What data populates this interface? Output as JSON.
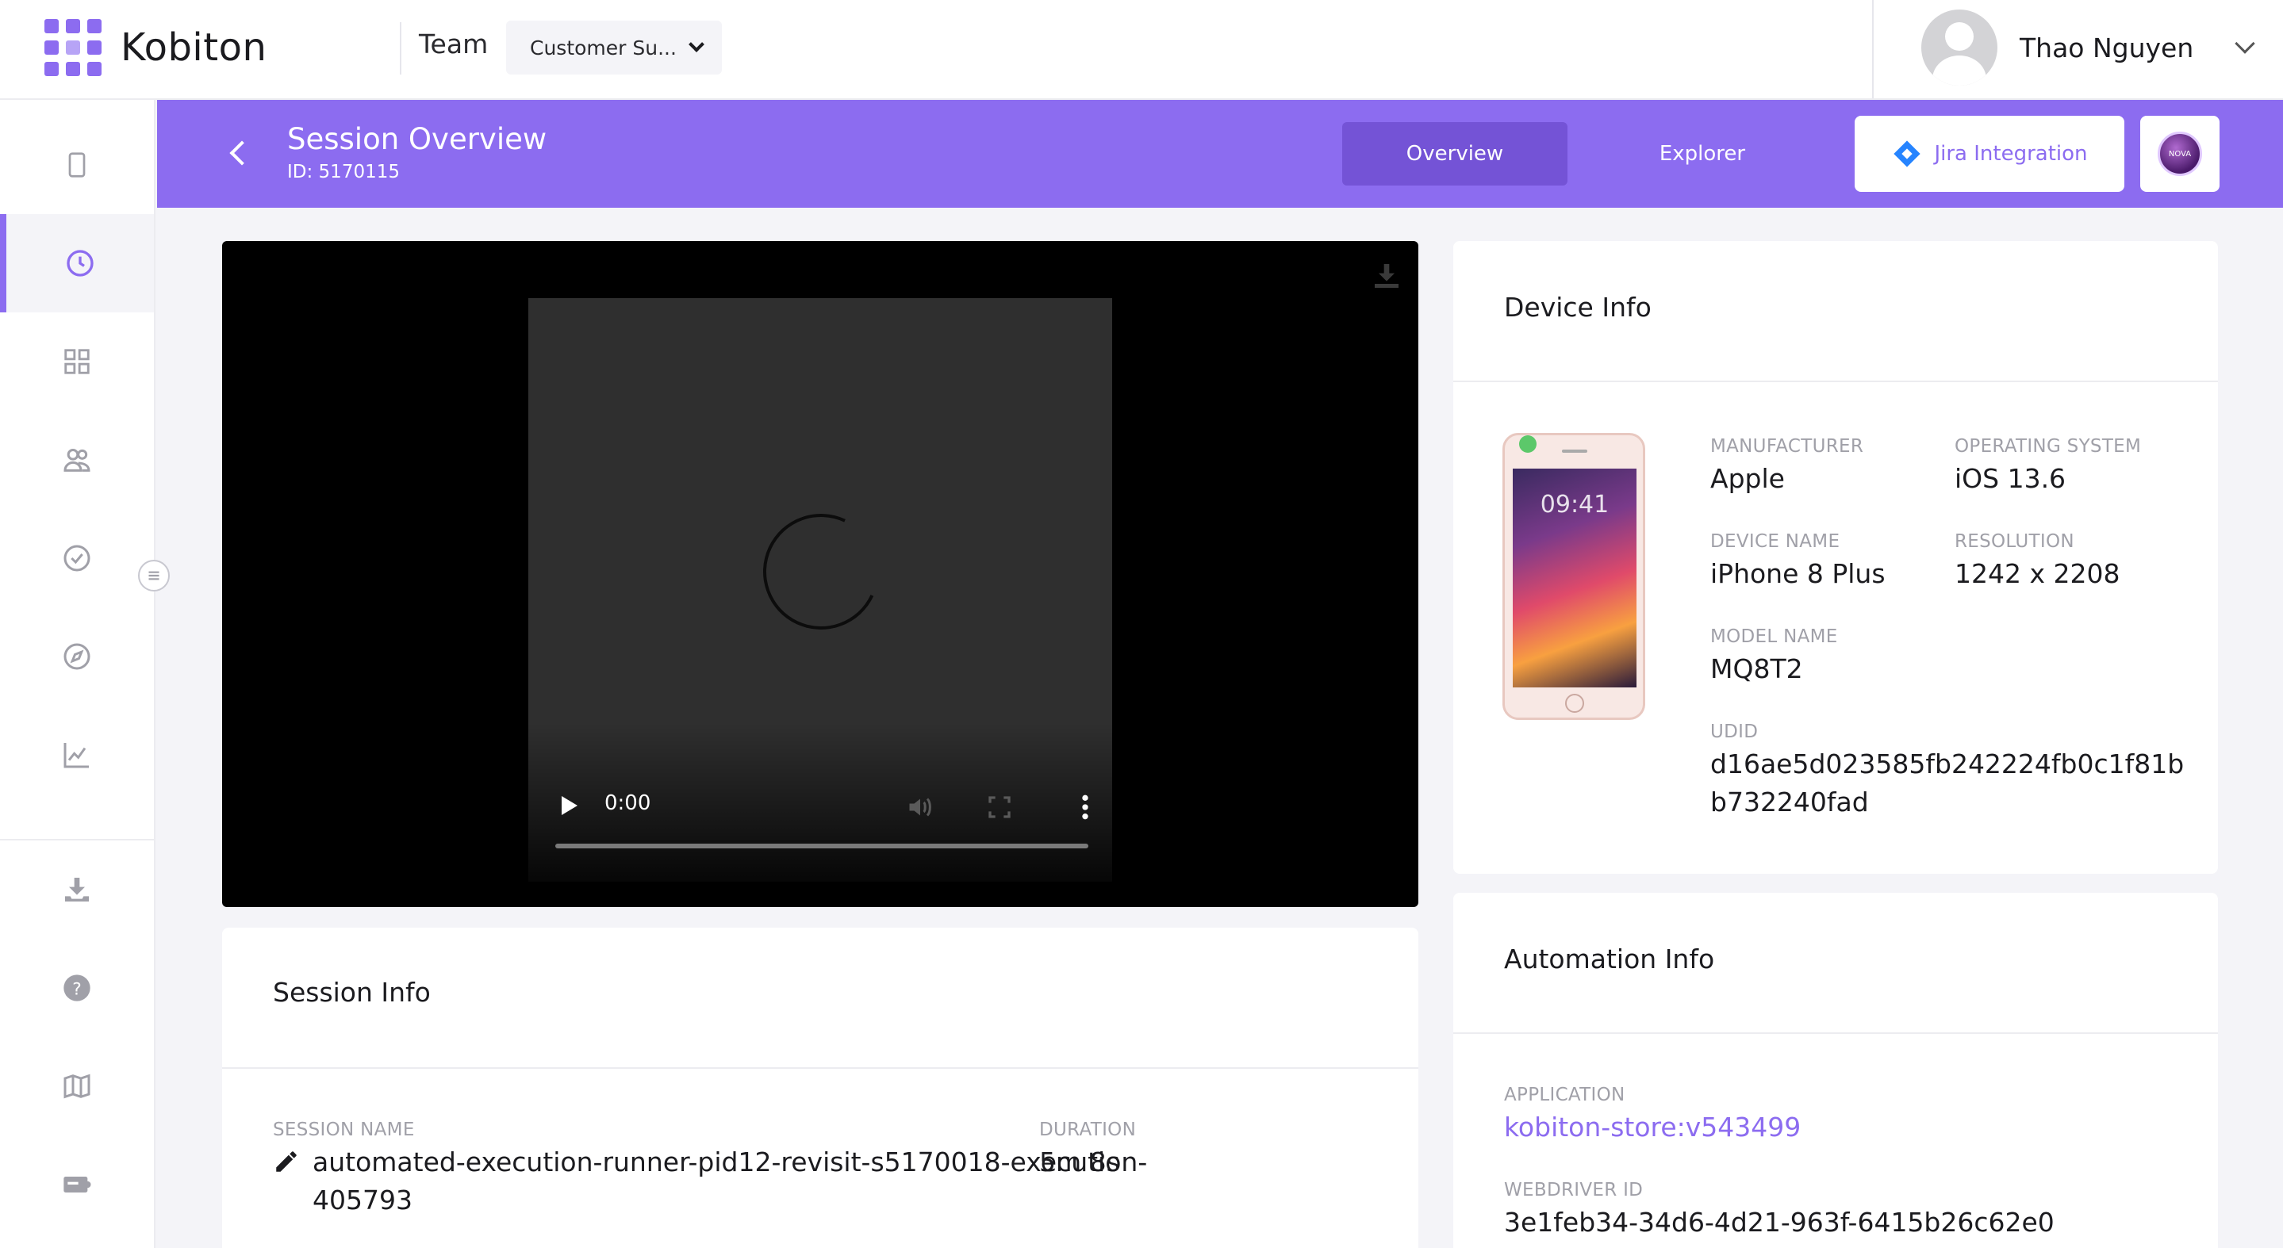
{
  "app": {
    "name": "Kobiton",
    "team_label": "Team",
    "team_selected": "Customer Su...",
    "user_name": "Thao Nguyen"
  },
  "header": {
    "title": "Session Overview",
    "id_text": "ID: 5170115",
    "tabs": [
      {
        "label": "Overview",
        "active": true
      },
      {
        "label": "Explorer",
        "active": false
      }
    ],
    "jira_label": "Jira Integration",
    "nova_label": "NOVA"
  },
  "sidebar": {
    "items": [
      {
        "icon": "device-icon",
        "active": false
      },
      {
        "icon": "clock-icon",
        "active": true
      },
      {
        "icon": "grid-icon",
        "active": false
      },
      {
        "icon": "users-icon",
        "active": false
      },
      {
        "icon": "check-circle-icon",
        "active": false
      },
      {
        "icon": "compass-icon",
        "active": false
      },
      {
        "icon": "chart-icon",
        "active": false
      },
      {
        "icon": "download-icon",
        "active": false
      },
      {
        "icon": "help-icon",
        "active": false
      },
      {
        "icon": "map-icon",
        "active": false
      },
      {
        "icon": "card-icon",
        "active": false
      }
    ]
  },
  "video": {
    "time": "0:00",
    "progress": 0
  },
  "device_info": {
    "title": "Device Info",
    "phone_time": "09:41",
    "fields": {
      "manufacturer_label": "MANUFACTURER",
      "manufacturer": "Apple",
      "os_label": "OPERATING SYSTEM",
      "os": "iOS 13.6",
      "device_name_label": "DEVICE NAME",
      "device_name": "iPhone 8 Plus",
      "resolution_label": "RESOLUTION",
      "resolution": "1242 x 2208",
      "model_label": "MODEL NAME",
      "model": "MQ8T2",
      "udid_label": "UDID",
      "udid_line1": "d16ae5d023585fb242224fb0c1f81b",
      "udid_line2": "b732240fad"
    }
  },
  "session_info": {
    "title": "Session Info",
    "session_name_label": "SESSION NAME",
    "session_name_line1": "automated-execution-runner-pid12-revisit-s5170018-execution-",
    "session_name_line2": "405793",
    "duration_label": "DURATION",
    "duration": "5m 8s"
  },
  "automation_info": {
    "title": "Automation Info",
    "application_label": "APPLICATION",
    "application": "kobiton-store:v543499",
    "webdriver_label": "WEBDRIVER ID",
    "webdriver": "3e1feb34-34d6-4d21-963f-6415b26c62e0"
  },
  "colors": {
    "accent": "#8c6cf0",
    "accent_dark": "#7453d6",
    "background": "#f4f4f8",
    "status_online": "#5cc86a"
  }
}
